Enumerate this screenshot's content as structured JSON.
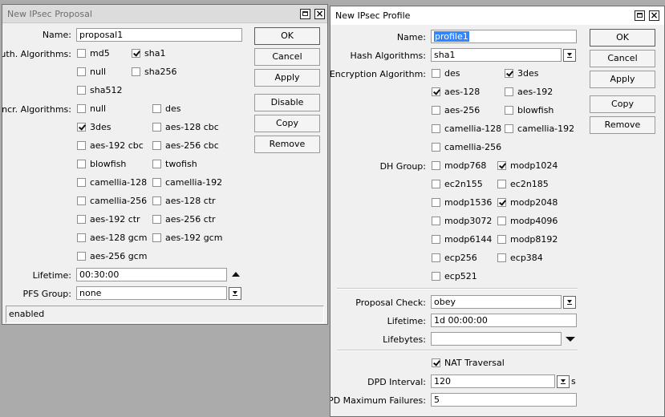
{
  "proposal": {
    "title": "New IPsec Proposal",
    "name_label": "Name:",
    "name_value": "proposal1",
    "auth_label": "Auth. Algorithms:",
    "auth": [
      {
        "label": "md5",
        "checked": false
      },
      {
        "label": "sha1",
        "checked": true
      },
      {
        "label": "null",
        "checked": false
      },
      {
        "label": "sha256",
        "checked": false
      },
      {
        "label": "sha512",
        "checked": false
      }
    ],
    "encr_label": "Encr. Algorithms:",
    "encr": [
      {
        "label": "null",
        "checked": false
      },
      {
        "label": "des",
        "checked": false
      },
      {
        "label": "3des",
        "checked": true
      },
      {
        "label": "aes-128 cbc",
        "checked": false
      },
      {
        "label": "aes-192 cbc",
        "checked": false
      },
      {
        "label": "aes-256 cbc",
        "checked": false
      },
      {
        "label": "blowfish",
        "checked": false
      },
      {
        "label": "twofish",
        "checked": false
      },
      {
        "label": "camellia-128",
        "checked": false
      },
      {
        "label": "camellia-192",
        "checked": false
      },
      {
        "label": "camellia-256",
        "checked": false
      },
      {
        "label": "aes-128 ctr",
        "checked": false
      },
      {
        "label": "aes-192 ctr",
        "checked": false
      },
      {
        "label": "aes-256 ctr",
        "checked": false
      },
      {
        "label": "aes-128 gcm",
        "checked": false
      },
      {
        "label": "aes-192 gcm",
        "checked": false
      },
      {
        "label": "aes-256 gcm",
        "checked": false
      }
    ],
    "lifetime_label": "Lifetime:",
    "lifetime_value": "00:30:00",
    "pfs_label": "PFS Group:",
    "pfs_value": "none",
    "buttons": {
      "ok": "OK",
      "cancel": "Cancel",
      "apply": "Apply",
      "disable": "Disable",
      "copy": "Copy",
      "remove": "Remove"
    },
    "status": "enabled"
  },
  "profile": {
    "title": "New IPsec Profile",
    "name_label": "Name:",
    "name_value": "profile1",
    "hash_label": "Hash Algorithms:",
    "hash_value": "sha1",
    "enc_label": "Encryption Algorithm:",
    "enc": [
      {
        "label": "des",
        "checked": false
      },
      {
        "label": "3des",
        "checked": true
      },
      {
        "label": "aes-128",
        "checked": true
      },
      {
        "label": "aes-192",
        "checked": false
      },
      {
        "label": "aes-256",
        "checked": false
      },
      {
        "label": "blowfish",
        "checked": false
      },
      {
        "label": "camellia-128",
        "checked": false
      },
      {
        "label": "camellia-192",
        "checked": false
      },
      {
        "label": "camellia-256",
        "checked": false
      }
    ],
    "dh_label": "DH Group:",
    "dh": [
      {
        "label": "modp768",
        "checked": false
      },
      {
        "label": "modp1024",
        "checked": true
      },
      {
        "label": "ec2n155",
        "checked": false
      },
      {
        "label": "ec2n185",
        "checked": false
      },
      {
        "label": "modp1536",
        "checked": false
      },
      {
        "label": "modp2048",
        "checked": true
      },
      {
        "label": "modp3072",
        "checked": false
      },
      {
        "label": "modp4096",
        "checked": false
      },
      {
        "label": "modp6144",
        "checked": false
      },
      {
        "label": "modp8192",
        "checked": false
      },
      {
        "label": "ecp256",
        "checked": false
      },
      {
        "label": "ecp384",
        "checked": false
      },
      {
        "label": "ecp521",
        "checked": false
      }
    ],
    "proposal_check_label": "Proposal Check:",
    "proposal_check_value": "obey",
    "lifetime_label": "Lifetime:",
    "lifetime_value": "1d 00:00:00",
    "lifebytes_label": "Lifebytes:",
    "lifebytes_value": "",
    "nat_label": "NAT Traversal",
    "nat_checked": true,
    "dpd_interval_label": "DPD Interval:",
    "dpd_interval_value": "120",
    "dpd_unit": "s",
    "dpd_max_label": "DPD Maximum Failures:",
    "dpd_max_value": "5",
    "buttons": {
      "ok": "OK",
      "cancel": "Cancel",
      "apply": "Apply",
      "copy": "Copy",
      "remove": "Remove"
    }
  }
}
